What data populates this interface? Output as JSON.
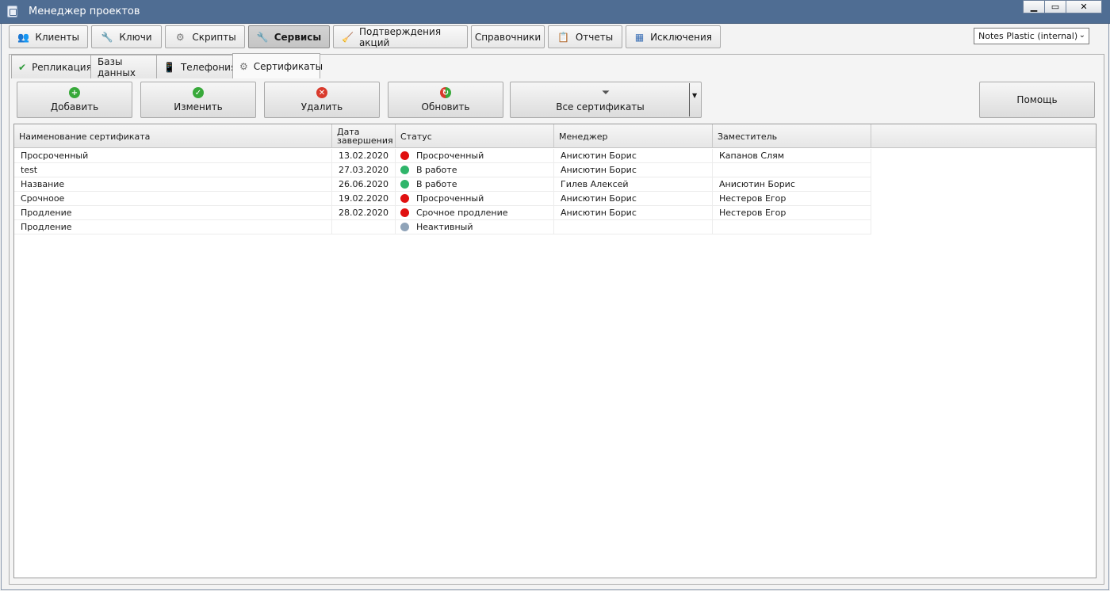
{
  "window": {
    "title": "Менеджер проектов"
  },
  "main_tabs": [
    {
      "label": "Клиенты",
      "icon": "users-icon"
    },
    {
      "label": "Ключи",
      "icon": "wrench-icon"
    },
    {
      "label": "Скрипты",
      "icon": "script-icon"
    },
    {
      "label": "Сервисы",
      "icon": "services-icon",
      "active": true
    },
    {
      "label": "Подтверждения акций",
      "icon": "broom-icon"
    },
    {
      "label": "Справочники"
    },
    {
      "label": "Отчеты",
      "icon": "report-icon"
    },
    {
      "label": "Исключения",
      "icon": "exceptions-icon"
    }
  ],
  "db_select": {
    "value": "Notes Plastic (internal)"
  },
  "sub_tabs": [
    {
      "label": "Репликация",
      "icon": "check-icon"
    },
    {
      "label": "Базы данных"
    },
    {
      "label": "Телефония",
      "icon": "phone-icon"
    },
    {
      "label": "Сертификаты",
      "icon": "certificate-icon",
      "active": true
    }
  ],
  "toolbar": {
    "add": "Добавить",
    "edit": "Изменить",
    "delete": "Удалить",
    "refresh": "Обновить",
    "filter": "Все сертификаты",
    "help": "Помощь"
  },
  "grid": {
    "columns": [
      "Наименование сертификата",
      "Дата завершения",
      "Статус",
      "Менеджер",
      "Заместитель"
    ],
    "rows": [
      {
        "name": "Просроченный",
        "date": "13.02.2020",
        "status": "Просроченный",
        "status_color": "#e01010",
        "manager": "Анисютин Борис",
        "deputy": "Капанов Слям"
      },
      {
        "name": "test",
        "date": "27.03.2020",
        "status": "В работе",
        "status_color": "#2fb56a",
        "manager": "Анисютин Борис",
        "deputy": ""
      },
      {
        "name": "Название",
        "date": "26.06.2020",
        "status": "В работе",
        "status_color": "#2fb56a",
        "manager": "Гилев Алексей",
        "deputy": "Анисютин Борис"
      },
      {
        "name": "Срочноое",
        "date": "19.02.2020",
        "status": "Просроченный",
        "status_color": "#e01010",
        "manager": "Анисютин Борис",
        "deputy": "Нестеров Егор"
      },
      {
        "name": "Продление",
        "date": "28.02.2020",
        "status": "Срочное продление",
        "status_color": "#e01010",
        "manager": "Анисютин Борис",
        "deputy": "Нестеров Егор"
      },
      {
        "name": "Продление",
        "date": "",
        "status": "Неактивный",
        "status_color": "#8fa3b8",
        "manager": "",
        "deputy": ""
      }
    ]
  }
}
